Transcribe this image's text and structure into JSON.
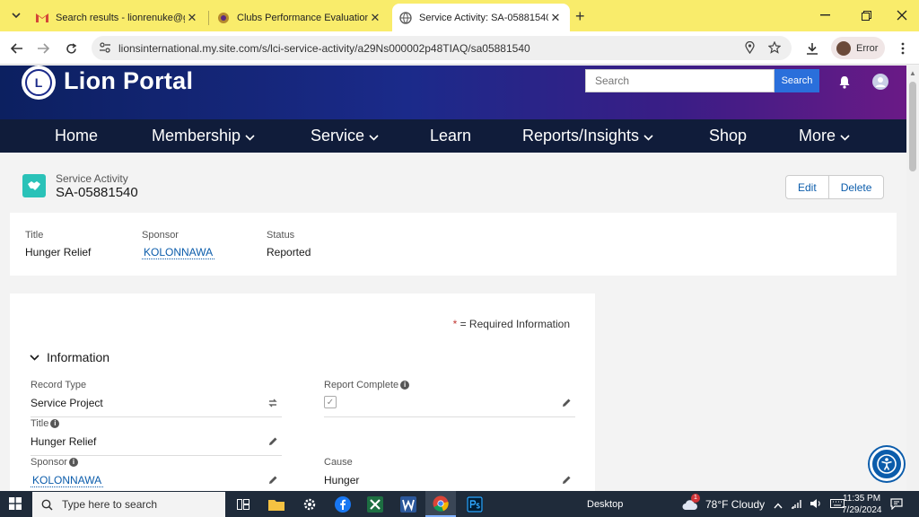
{
  "browser": {
    "tabs": [
      {
        "title": "Search results - lionrenuke@gm",
        "active": false
      },
      {
        "title": "Clubs Performance Evaluation S",
        "active": false
      },
      {
        "title": "Service Activity: SA-05881540",
        "active": true
      }
    ],
    "url": "lionsinternational.my.site.com/s/lci-service-activity/a29Ns000002p48TIAQ/sa05881540",
    "profile_label": "Error"
  },
  "portal": {
    "brand": "Lion Portal",
    "logo_letter": "L",
    "search_placeholder": "Search",
    "search_button": "Search",
    "nav": [
      "Home",
      "Membership",
      "Service",
      "Learn",
      "Reports/Insights",
      "Shop",
      "More"
    ]
  },
  "record": {
    "object_type": "Service Activity",
    "name": "SA-05881540",
    "actions": {
      "edit": "Edit",
      "delete": "Delete"
    },
    "highlights": {
      "title_label": "Title",
      "title_value": "Hunger Relief",
      "sponsor_label": "Sponsor",
      "sponsor_value": "KOLONNAWA",
      "status_label": "Status",
      "status_value": "Reported"
    },
    "required_text": "= Required Information",
    "required_star": "*",
    "section_title": "Information",
    "fields": {
      "record_type_label": "Record Type",
      "record_type_value": "Service Project",
      "report_complete_label": "Report Complete",
      "title_label": "Title",
      "title_value": "Hunger Relief",
      "sponsor_label": "Sponsor",
      "sponsor_value": "KOLONNAWA",
      "cause_label": "Cause",
      "cause_value": "Hunger"
    }
  },
  "taskbar": {
    "search_placeholder": "Type here to search",
    "desktop_label": "Desktop",
    "weather": "78°F  Cloudy",
    "weather_badge": "1",
    "time": "11:35 PM",
    "date": "7/29/2024"
  },
  "colors": {
    "tabbar": "#f9ec6b",
    "banner_start": "#0c2060",
    "banner_end": "#6a1a86",
    "nav": "#101c3a",
    "link": "#0b5cab",
    "object_icon": "#2ac2b8"
  }
}
